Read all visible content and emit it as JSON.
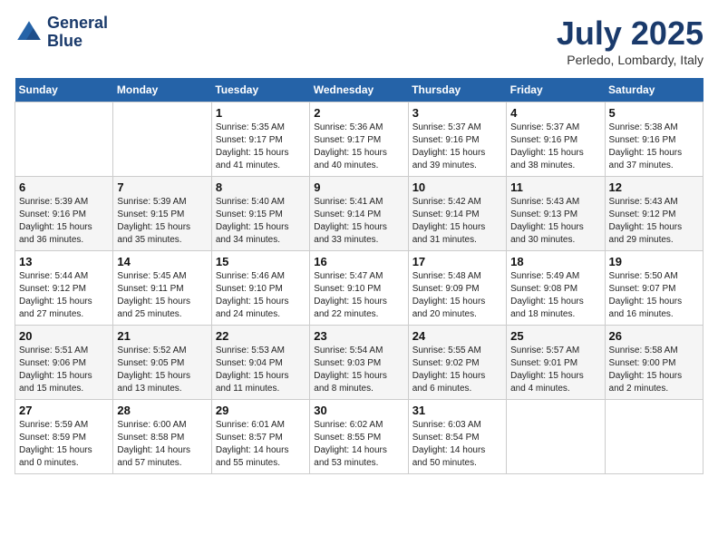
{
  "header": {
    "logo_line1": "General",
    "logo_line2": "Blue",
    "month_title": "July 2025",
    "location": "Perledo, Lombardy, Italy"
  },
  "columns": [
    "Sunday",
    "Monday",
    "Tuesday",
    "Wednesday",
    "Thursday",
    "Friday",
    "Saturday"
  ],
  "weeks": [
    [
      {
        "day": "",
        "info": ""
      },
      {
        "day": "",
        "info": ""
      },
      {
        "day": "1",
        "info": "Sunrise: 5:35 AM\nSunset: 9:17 PM\nDaylight: 15 hours\nand 41 minutes."
      },
      {
        "day": "2",
        "info": "Sunrise: 5:36 AM\nSunset: 9:17 PM\nDaylight: 15 hours\nand 40 minutes."
      },
      {
        "day": "3",
        "info": "Sunrise: 5:37 AM\nSunset: 9:16 PM\nDaylight: 15 hours\nand 39 minutes."
      },
      {
        "day": "4",
        "info": "Sunrise: 5:37 AM\nSunset: 9:16 PM\nDaylight: 15 hours\nand 38 minutes."
      },
      {
        "day": "5",
        "info": "Sunrise: 5:38 AM\nSunset: 9:16 PM\nDaylight: 15 hours\nand 37 minutes."
      }
    ],
    [
      {
        "day": "6",
        "info": "Sunrise: 5:39 AM\nSunset: 9:16 PM\nDaylight: 15 hours\nand 36 minutes."
      },
      {
        "day": "7",
        "info": "Sunrise: 5:39 AM\nSunset: 9:15 PM\nDaylight: 15 hours\nand 35 minutes."
      },
      {
        "day": "8",
        "info": "Sunrise: 5:40 AM\nSunset: 9:15 PM\nDaylight: 15 hours\nand 34 minutes."
      },
      {
        "day": "9",
        "info": "Sunrise: 5:41 AM\nSunset: 9:14 PM\nDaylight: 15 hours\nand 33 minutes."
      },
      {
        "day": "10",
        "info": "Sunrise: 5:42 AM\nSunset: 9:14 PM\nDaylight: 15 hours\nand 31 minutes."
      },
      {
        "day": "11",
        "info": "Sunrise: 5:43 AM\nSunset: 9:13 PM\nDaylight: 15 hours\nand 30 minutes."
      },
      {
        "day": "12",
        "info": "Sunrise: 5:43 AM\nSunset: 9:12 PM\nDaylight: 15 hours\nand 29 minutes."
      }
    ],
    [
      {
        "day": "13",
        "info": "Sunrise: 5:44 AM\nSunset: 9:12 PM\nDaylight: 15 hours\nand 27 minutes."
      },
      {
        "day": "14",
        "info": "Sunrise: 5:45 AM\nSunset: 9:11 PM\nDaylight: 15 hours\nand 25 minutes."
      },
      {
        "day": "15",
        "info": "Sunrise: 5:46 AM\nSunset: 9:10 PM\nDaylight: 15 hours\nand 24 minutes."
      },
      {
        "day": "16",
        "info": "Sunrise: 5:47 AM\nSunset: 9:10 PM\nDaylight: 15 hours\nand 22 minutes."
      },
      {
        "day": "17",
        "info": "Sunrise: 5:48 AM\nSunset: 9:09 PM\nDaylight: 15 hours\nand 20 minutes."
      },
      {
        "day": "18",
        "info": "Sunrise: 5:49 AM\nSunset: 9:08 PM\nDaylight: 15 hours\nand 18 minutes."
      },
      {
        "day": "19",
        "info": "Sunrise: 5:50 AM\nSunset: 9:07 PM\nDaylight: 15 hours\nand 16 minutes."
      }
    ],
    [
      {
        "day": "20",
        "info": "Sunrise: 5:51 AM\nSunset: 9:06 PM\nDaylight: 15 hours\nand 15 minutes."
      },
      {
        "day": "21",
        "info": "Sunrise: 5:52 AM\nSunset: 9:05 PM\nDaylight: 15 hours\nand 13 minutes."
      },
      {
        "day": "22",
        "info": "Sunrise: 5:53 AM\nSunset: 9:04 PM\nDaylight: 15 hours\nand 11 minutes."
      },
      {
        "day": "23",
        "info": "Sunrise: 5:54 AM\nSunset: 9:03 PM\nDaylight: 15 hours\nand 8 minutes."
      },
      {
        "day": "24",
        "info": "Sunrise: 5:55 AM\nSunset: 9:02 PM\nDaylight: 15 hours\nand 6 minutes."
      },
      {
        "day": "25",
        "info": "Sunrise: 5:57 AM\nSunset: 9:01 PM\nDaylight: 15 hours\nand 4 minutes."
      },
      {
        "day": "26",
        "info": "Sunrise: 5:58 AM\nSunset: 9:00 PM\nDaylight: 15 hours\nand 2 minutes."
      }
    ],
    [
      {
        "day": "27",
        "info": "Sunrise: 5:59 AM\nSunset: 8:59 PM\nDaylight: 15 hours\nand 0 minutes."
      },
      {
        "day": "28",
        "info": "Sunrise: 6:00 AM\nSunset: 8:58 PM\nDaylight: 14 hours\nand 57 minutes."
      },
      {
        "day": "29",
        "info": "Sunrise: 6:01 AM\nSunset: 8:57 PM\nDaylight: 14 hours\nand 55 minutes."
      },
      {
        "day": "30",
        "info": "Sunrise: 6:02 AM\nSunset: 8:55 PM\nDaylight: 14 hours\nand 53 minutes."
      },
      {
        "day": "31",
        "info": "Sunrise: 6:03 AM\nSunset: 8:54 PM\nDaylight: 14 hours\nand 50 minutes."
      },
      {
        "day": "",
        "info": ""
      },
      {
        "day": "",
        "info": ""
      }
    ]
  ]
}
